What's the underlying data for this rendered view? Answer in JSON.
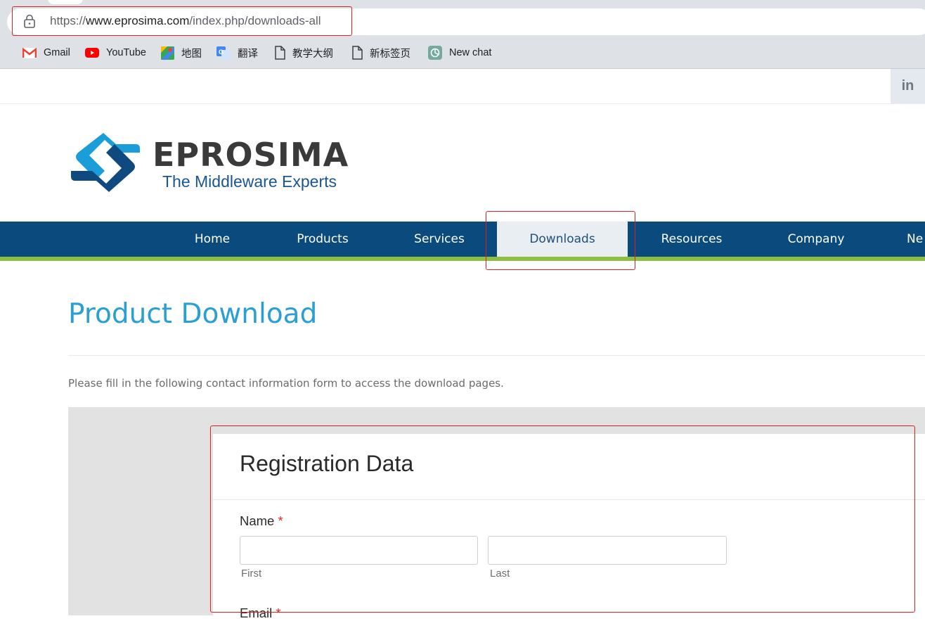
{
  "browser": {
    "url_scheme": "https://",
    "url_host": "www.eprosima.com",
    "url_path": "/index.php/downloads-all",
    "bookmarks": [
      {
        "label": "Gmail",
        "icon": "gmail-icon"
      },
      {
        "label": "YouTube",
        "icon": "youtube-icon"
      },
      {
        "label": "地图",
        "icon": "maps-icon"
      },
      {
        "label": "翻译",
        "icon": "translate-icon"
      },
      {
        "label": "教学大纲",
        "icon": "page-icon"
      },
      {
        "label": "新标签页",
        "icon": "page-icon"
      },
      {
        "label": "New chat",
        "icon": "chatgpt-icon"
      }
    ]
  },
  "site": {
    "linkedin_label": "in",
    "logo_name": "EPROSIMA",
    "logo_tagline": "The Middleware Experts",
    "colors": {
      "nav": "#0b4a7d",
      "accent_green": "#8cbf3f",
      "title_blue": "#2a9fd6",
      "required": "#e02b2b"
    }
  },
  "nav": {
    "items": [
      {
        "label": "Home"
      },
      {
        "label": "Products"
      },
      {
        "label": "Services"
      },
      {
        "label": "Downloads",
        "active": true
      },
      {
        "label": "Resources"
      },
      {
        "label": "Company"
      },
      {
        "label": "Ne"
      }
    ]
  },
  "content": {
    "title": "Product Download",
    "intro": "Please fill in the following contact information form to access the download pages."
  },
  "form": {
    "title": "Registration Data",
    "name_label": "Name",
    "required_mark": "*",
    "first_sublabel": "First",
    "last_sublabel": "Last",
    "first_value": "",
    "last_value": "",
    "email_label": "Email"
  }
}
